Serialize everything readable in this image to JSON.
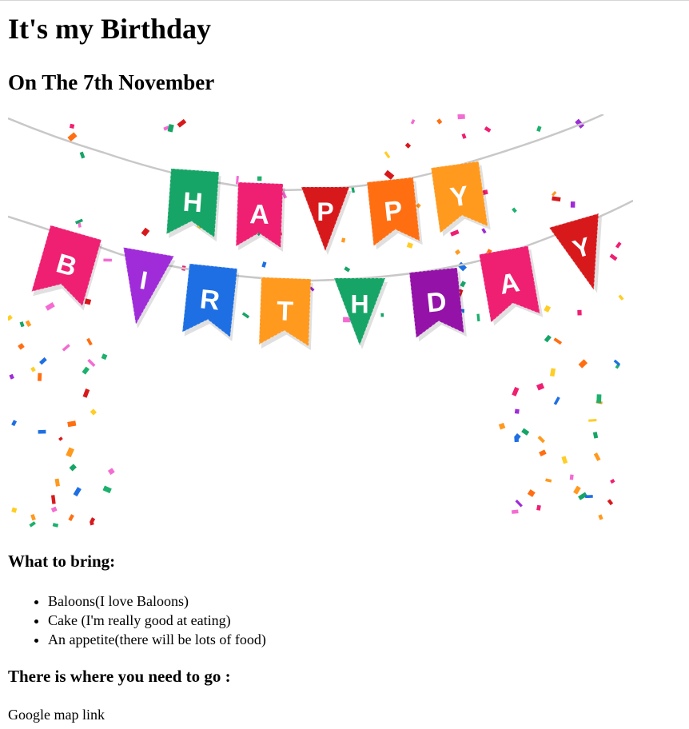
{
  "page": {
    "title": "It's my Birthday",
    "subtitle": "On The 7th November"
  },
  "banner": {
    "top_row_letters": [
      "H",
      "A",
      "P",
      "P",
      "Y"
    ],
    "bottom_row_letters": [
      "B",
      "I",
      "R",
      "T",
      "H",
      "D",
      "A",
      "Y"
    ],
    "colors": {
      "green": "#16a566",
      "pink": "#ef1f72",
      "red": "#d8191c",
      "orange": "#ff6f12",
      "amber": "#ff9a1f",
      "purple": "#9f2bd9",
      "blue": "#1e6fe3",
      "violet": "#9412a8"
    }
  },
  "bring": {
    "heading": "What to bring:",
    "items": [
      "Baloons(I love Baloons)",
      "Cake (I'm really good at eating)",
      "An appetite(there will be lots of food)"
    ]
  },
  "location": {
    "heading": "There is where you need to go :",
    "link_text": "Google map link"
  }
}
